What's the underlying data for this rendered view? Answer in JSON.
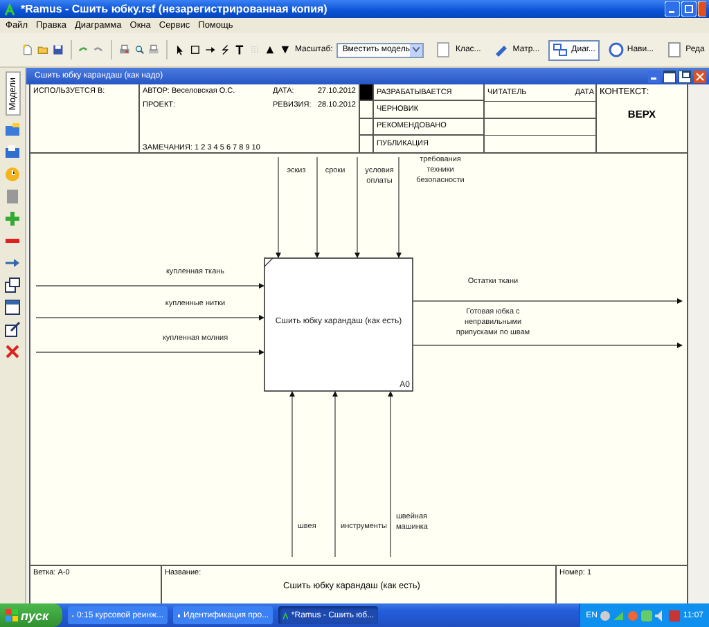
{
  "window": {
    "title": "*Ramus - Сшить юбку.rsf (незарегистрированная копия)"
  },
  "menu": [
    "Файл",
    "Правка",
    "Диаграмма",
    "Окна",
    "Сервис",
    "Помощь"
  ],
  "toolbar": {
    "zoom_label": "Масштаб:",
    "zoom_value": "Вместить модель",
    "views": [
      {
        "label": "Клас...",
        "selected": false
      },
      {
        "label": "Матр...",
        "selected": false
      },
      {
        "label": "Диаг...",
        "selected": true
      },
      {
        "label": "Нави...",
        "selected": false
      },
      {
        "label": "Реда",
        "selected": false
      }
    ]
  },
  "sidebar": {
    "tab": "Модели"
  },
  "document": {
    "title": "Сшить юбку карандаш (как надо)",
    "header": {
      "used_in": "ИСПОЛЬЗУЕТСЯ В:",
      "author": "АВТОР: Веселовская О.С.",
      "date_label": "ДАТА:",
      "date": "27.10.2012",
      "project": "ПРОЕКТ:",
      "revision_label": "РЕВИЗИЯ:",
      "revision": "28.10.2012",
      "notes": "ЗАМЕЧАНИЯ:  1 2 3 4 5 6 7 8 9 10",
      "statuses": [
        {
          "label": "РАЗРАБАТЫВАЕТСЯ",
          "selected": true
        },
        {
          "label": "ЧЕРНОВИК",
          "selected": false
        },
        {
          "label": "РЕКОМЕНДОВАНО",
          "selected": false
        },
        {
          "label": "ПУБЛИКАЦИЯ",
          "selected": false
        }
      ],
      "reader": "ЧИТАТЕЛЬ",
      "reader_date": "ДАТА",
      "context": "КОНТЕКСТ:",
      "context_value": "ВЕРХ"
    },
    "diagram": {
      "box": {
        "label": "Сшить юбку карандаш (как есть)",
        "id": "A0"
      },
      "arrows": [
        {
          "kind": "input",
          "label": "купленная ткань"
        },
        {
          "kind": "input",
          "label": "купленные нитки"
        },
        {
          "kind": "input",
          "label": "купленная молния"
        },
        {
          "kind": "control",
          "label": "эскиз"
        },
        {
          "kind": "control",
          "label": "сроки"
        },
        {
          "kind": "control",
          "label": "условия оплаты"
        },
        {
          "kind": "control",
          "label": "требования техники безопасности"
        },
        {
          "kind": "output",
          "label": "Остатки ткани"
        },
        {
          "kind": "output",
          "label": "Готовая юбка с неправильными припусками по швам"
        },
        {
          "kind": "mechanism",
          "label": "швея"
        },
        {
          "kind": "mechanism",
          "label": "инструменты"
        },
        {
          "kind": "mechanism",
          "label": "швейная машинка"
        }
      ]
    },
    "footer": {
      "branch": "Ветка: А-0",
      "name_label": "Название:",
      "name": "Сшить юбку карандаш (как есть)",
      "number": "Номер: 1"
    }
  },
  "taskbar": {
    "start": "пуск",
    "tasks": [
      {
        "label": "0:15 курсовой реинж...",
        "selected": false
      },
      {
        "label": "Идентификация про...",
        "selected": false
      },
      {
        "label": "*Ramus - Сшить юб...",
        "selected": true
      }
    ],
    "language": "EN",
    "time": "11:07"
  }
}
